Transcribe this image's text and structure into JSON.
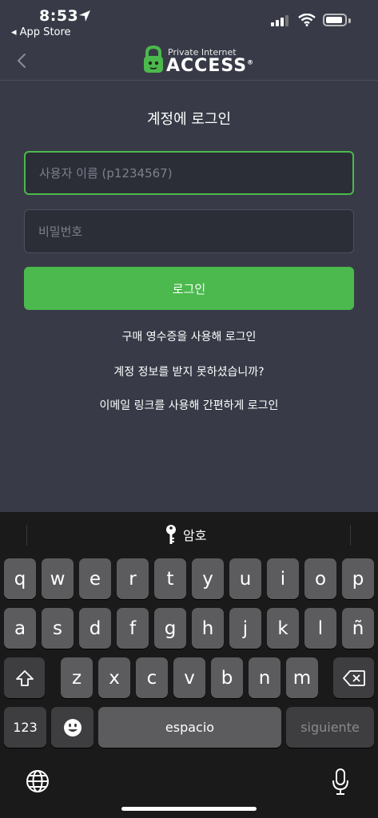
{
  "status": {
    "time": "8:53",
    "back_app": "◂ App Store"
  },
  "nav": {
    "logo_small": "Private Internet",
    "logo_big": "ACCESS",
    "logo_mark": "®"
  },
  "title": "계정에 로그인",
  "username": {
    "placeholder": "사용자 이름 (p1234567)"
  },
  "password": {
    "placeholder": "비밀번호"
  },
  "login_button": "로그인",
  "links": [
    "구매 영수증을 사용해 로그인",
    "계정 정보를 받지 못하셨습니까?",
    "이메일 링크를 사용해 간편하게 로그인"
  ],
  "keyboard": {
    "suggestion": "암호",
    "row1": [
      "q",
      "w",
      "e",
      "r",
      "t",
      "y",
      "u",
      "i",
      "o",
      "p"
    ],
    "row2": [
      "a",
      "s",
      "d",
      "f",
      "g",
      "h",
      "j",
      "k",
      "l",
      "ñ"
    ],
    "row3": [
      "z",
      "x",
      "c",
      "v",
      "b",
      "n",
      "m"
    ],
    "numbers": "123",
    "space": "espacio",
    "next": "siguiente"
  },
  "colors": {
    "accent": "#4bb94d",
    "background": "#383b47",
    "keyboard": "#1a1a1a"
  },
  "icons": [
    "location-arrow-icon",
    "signal-icon",
    "wifi-icon",
    "battery-icon",
    "back-chevron-icon",
    "pia-lock-icon",
    "key-icon",
    "shift-icon",
    "delete-icon",
    "emoji-icon",
    "globe-icon",
    "mic-icon"
  ]
}
